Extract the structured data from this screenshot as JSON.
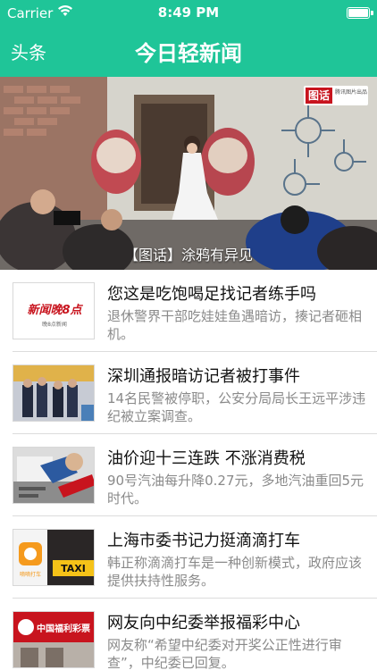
{
  "status_bar": {
    "carrier": "Carrier",
    "time": "8:49 PM",
    "battery_level": 1.0
  },
  "nav": {
    "left_label": "头条",
    "title": "今日轻新闻"
  },
  "banner": {
    "caption": "【图话】涂鸦有异见",
    "logo_text": "图话",
    "logo_subtitle": "腾讯图片出品"
  },
  "news": [
    {
      "title": "您这是吃饱喝足找记者练手吗",
      "description": "退休警界干部吃娃娃鱼遇暗访，揍记者砸相机。",
      "thumb_text": "新闻晚8点",
      "thumb_subtext": "晚8点新闻"
    },
    {
      "title": "深圳通报暗访记者被打事件",
      "description": "14名民警被停职，公安分局局长王远平涉违纪被立案调查。"
    },
    {
      "title": "油价迎十三连跌 不涨消费税",
      "description": "90号汽油每升降0.27元，多地汽油重回5元时代。"
    },
    {
      "title": "上海市委书记力挺滴滴打车",
      "description": "韩正称滴滴打车是一种创新模式，政府应该提供扶持性服务。",
      "thumb_text": "TAXI",
      "thumb_subtext": "嘀嘀打车"
    },
    {
      "title": "网友向中纪委举报福彩中心",
      "description": "网友称“希望中纪委对开奖公正性进行审查”，中纪委已回复。",
      "thumb_text": "中国福利彩票"
    }
  ],
  "colors": {
    "header": "#1fc598",
    "title_text": "#111111",
    "desc_text": "#8a8a8a"
  }
}
